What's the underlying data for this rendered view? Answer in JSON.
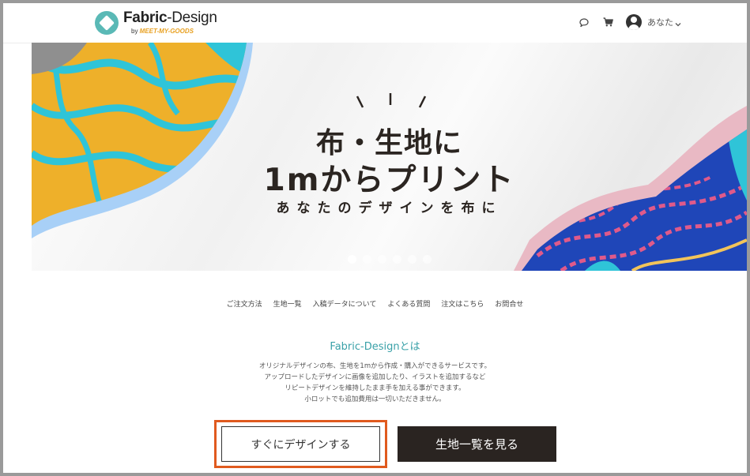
{
  "header": {
    "logo": {
      "title_bold": "Fabric",
      "title_rest": "-Design",
      "sub_prefix": "by ",
      "sub_brand": "MEET-MY-GOODS"
    },
    "user_name": "あなた"
  },
  "banner": {
    "headline_line1": "布・生地に",
    "headline_line2": "1mからプリント",
    "tagline": "あなたのデザインを布に",
    "slide_count": 6,
    "active_slide": 1
  },
  "nav_links": [
    "ご注文方法",
    "生地一覧",
    "入稿データについて",
    "よくある質問",
    "注文はこちら",
    "お問合せ"
  ],
  "about": {
    "title": "Fabric-Designとは",
    "lines": [
      "オリジナルデザインの布、生地を1mから作成・購入ができるサービスです。",
      "アップロードしたデザインに画像を追加したり、イラストを追加するなど",
      "リピートデザインを維持したまま手を加える事ができます。",
      "小ロットでも追加費用は一切いただきません。"
    ]
  },
  "buttons": {
    "design_now": "すぐにデザインする",
    "fabric_list": "生地一覧を見る"
  },
  "colors": {
    "accent_teal": "#3aa1a8",
    "highlight": "#e05a1e",
    "dark_button": "#2a2421",
    "fabric_yellow": "#eeb02a",
    "fabric_cyan": "#2fc4d8",
    "fabric_blue": "#1f46b8",
    "fabric_pink": "#e05a8a"
  },
  "icons": [
    "chat-icon",
    "cart-icon",
    "avatar-icon",
    "chevron-down-icon"
  ]
}
